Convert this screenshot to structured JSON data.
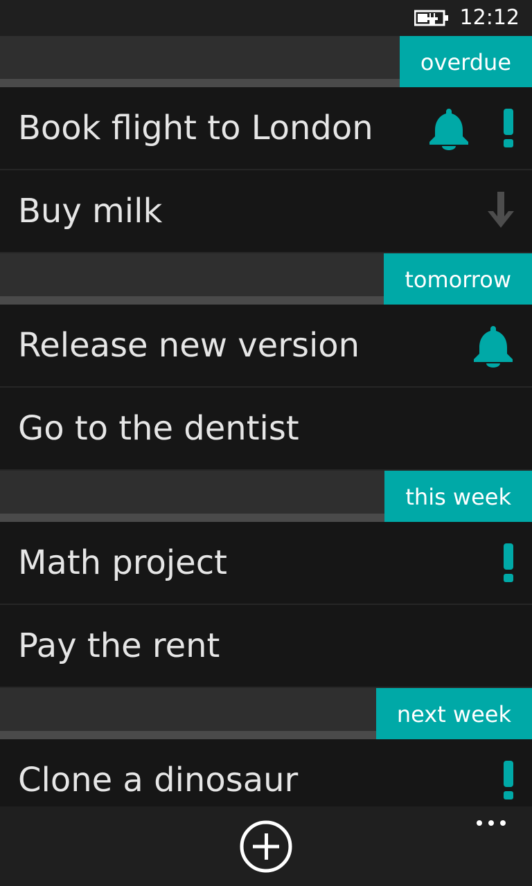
{
  "status": {
    "time": "12:12",
    "battery_icon": "battery-charging-icon"
  },
  "colors": {
    "accent": "#00a9a7",
    "background": "#161616",
    "header_bg": "#2f2f2f",
    "muted_icon": "#4d4d4d"
  },
  "groups": [
    {
      "label": "overdue",
      "tasks": [
        {
          "title": "Book flight to London",
          "icons": [
            "bell-icon",
            "exclamation-icon"
          ]
        },
        {
          "title": "Buy milk",
          "icons": [
            "arrow-down-icon"
          ]
        }
      ]
    },
    {
      "label": "tomorrow",
      "tasks": [
        {
          "title": "Release new version",
          "icons": [
            "bell-icon"
          ]
        },
        {
          "title": "Go to the dentist",
          "icons": []
        }
      ]
    },
    {
      "label": "this week",
      "tasks": [
        {
          "title": "Math project",
          "icons": [
            "exclamation-icon"
          ]
        },
        {
          "title": "Pay the rent",
          "icons": []
        }
      ]
    },
    {
      "label": "next week",
      "tasks": [
        {
          "title": "Clone a dinosaur",
          "icons": [
            "exclamation-icon"
          ]
        }
      ]
    }
  ],
  "app_bar": {
    "add_icon": "add-circle-icon",
    "more_icon": "more-icon"
  }
}
